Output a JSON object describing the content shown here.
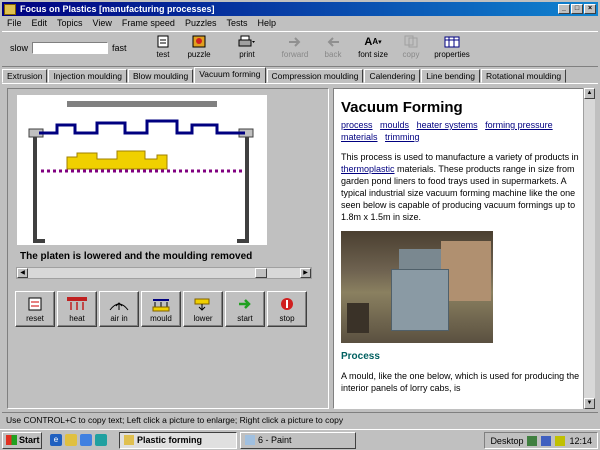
{
  "window": {
    "title": "Focus on Plastics [manufacturing processes]",
    "controls": [
      "_",
      "□",
      "×"
    ]
  },
  "menu": [
    "File",
    "Edit",
    "Topics",
    "View",
    "Frame speed",
    "Puzzles",
    "Tests",
    "Help"
  ],
  "toolbar": {
    "slow_label": "slow",
    "fast_label": "fast",
    "buttons": {
      "test": "test",
      "puzzle": "puzzle",
      "print": "print",
      "forward": "forward",
      "back": "back",
      "font_size": "font size",
      "copy": "copy",
      "properties": "properties"
    }
  },
  "tabs": [
    "Extrusion",
    "Injection moulding",
    "Blow moulding",
    "Vacuum forming",
    "Compression moulding",
    "Calendering",
    "Line bending",
    "Rotational moulding"
  ],
  "active_tab": "Vacuum forming",
  "animation": {
    "caption": "The platen is lowered and the moulding removed"
  },
  "controls": [
    "reset",
    "heat",
    "air in",
    "mould",
    "lower",
    "start",
    "stop"
  ],
  "article": {
    "title": "Vacuum Forming",
    "links": [
      "process",
      "moulds",
      "heater systems",
      "forming pressure",
      "materials",
      "trimming"
    ],
    "para1_before": "This process is used to manufacture a variety of products in ",
    "para1_link": "thermoplastic",
    "para1_after": " materials. These products range in size from garden pond liners to food trays used in supermarkets. A typical industrial size vacuum forming machine like the one seen below  is capable of producing vacuum formings up to 1.8m x 1.5m in size.",
    "subheading": "Process",
    "para2": "A mould, like the one below, which is used for producing the interior panels of lorry cabs, is"
  },
  "status": "Use CONTROL+C to copy text; Left click a picture to enlarge; Right click a picture to copy",
  "taskbar": {
    "start": "Start",
    "tasks": [
      "Plastic forming",
      "6 - Paint"
    ],
    "tray_label": "Desktop",
    "clock": "12:14"
  }
}
